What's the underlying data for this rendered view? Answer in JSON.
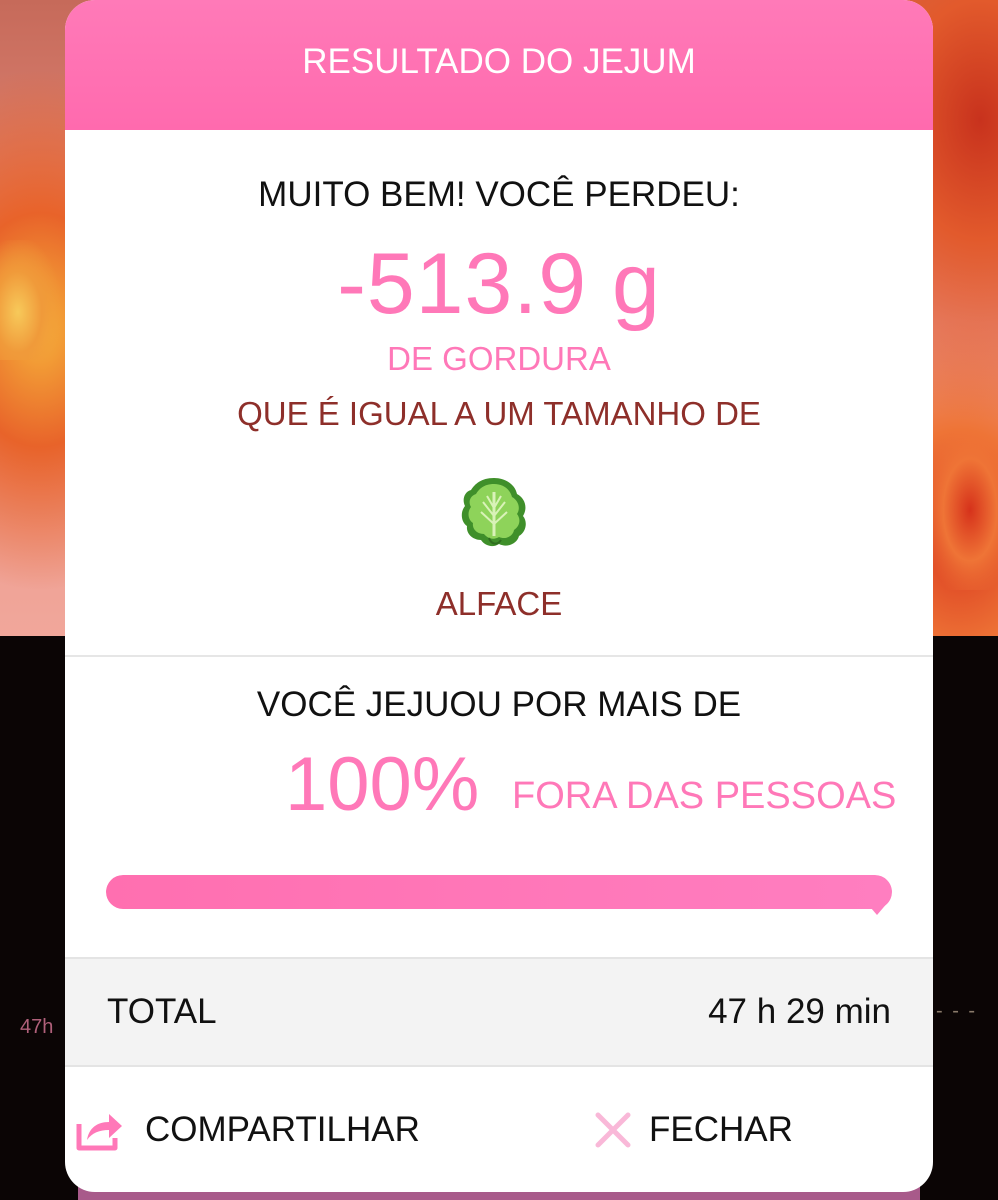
{
  "background": {
    "left_hint": "47h",
    "right_hint": "- - -"
  },
  "modal": {
    "title": "RESULTADO DO JEJUM",
    "result": {
      "intro": "MUITO BEM! VOCÊ PERDEU:",
      "value": "-513.9 g",
      "unit_text": "DE GORDURA",
      "compare_text": "QUE É IGUAL A UM TAMANHO DE",
      "food_icon": "lettuce-icon",
      "food_name": "ALFACE"
    },
    "rank": {
      "intro": "VOCÊ JEJUOU POR MAIS DE",
      "percent": "100%",
      "caption": "FORA DAS PESSOAS",
      "progress_fraction": 1.0
    },
    "total": {
      "label": "TOTAL",
      "value": "47 h 29 min"
    },
    "actions": {
      "share_label": "COMPARTILHAR",
      "share_icon": "share-icon",
      "close_label": "FECHAR",
      "close_icon": "close-icon"
    }
  },
  "colors": {
    "accent_pink": "#ff78b8",
    "header_pink": "#ff6aae",
    "text_brown": "#8e2f2a",
    "text_dark": "#111111"
  }
}
